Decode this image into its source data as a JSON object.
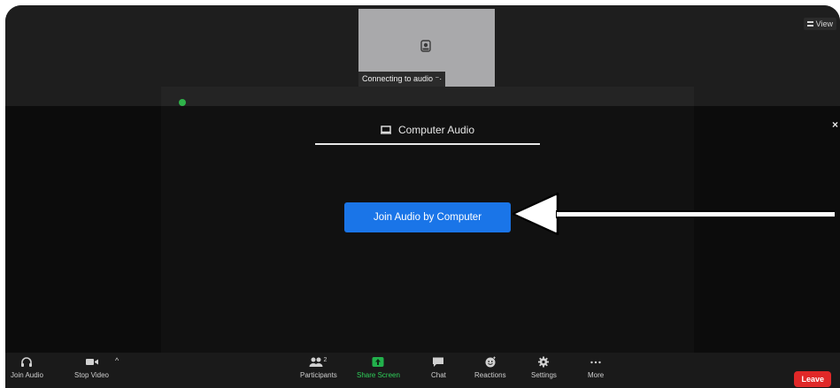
{
  "video": {
    "view_label": "View",
    "tile_caption": "Connecting to audio ⁻·"
  },
  "audio_panel": {
    "tab_label": "Computer Audio",
    "close_label": "×",
    "join_button_label": "Join Audio by Computer"
  },
  "toolbar": {
    "join_audio": "Join Audio",
    "stop_video": "Stop Video",
    "participants": "Participants",
    "participants_count": "2",
    "share_screen": "Share Screen",
    "chat": "Chat",
    "reactions": "Reactions",
    "settings": "Settings",
    "more": "More",
    "leave": "Leave"
  },
  "colors": {
    "accent": "#1a75e8",
    "leave": "#e02828",
    "share": "#22b14c"
  },
  "icons": [
    "view-grid-icon",
    "avatar-icon",
    "shield-icon",
    "computer-icon",
    "close-icon",
    "pointer-arrow",
    "headphones-icon",
    "video-camera-icon",
    "chevron-up-icon",
    "participants-icon",
    "share-screen-icon",
    "chat-icon",
    "reactions-icon",
    "gear-icon",
    "more-icon"
  ]
}
